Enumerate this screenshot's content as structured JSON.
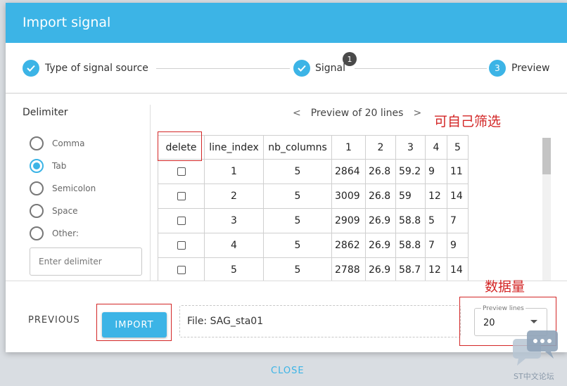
{
  "dialog": {
    "title": "Import signal"
  },
  "stepper": {
    "steps": [
      {
        "label": "Type of signal source",
        "state": "done"
      },
      {
        "label": "Signal",
        "state": "done",
        "badge": "1"
      },
      {
        "label": "Preview",
        "state": "active",
        "number": "3"
      }
    ]
  },
  "delimiter": {
    "title": "Delimiter",
    "options": [
      {
        "label": "Comma",
        "checked": false
      },
      {
        "label": "Tab",
        "checked": true
      },
      {
        "label": "Semicolon",
        "checked": false
      },
      {
        "label": "Space",
        "checked": false
      },
      {
        "label": "Other:",
        "checked": false
      }
    ],
    "input_placeholder": "Enter delimiter"
  },
  "preview": {
    "nav_prev": "<",
    "nav_text": "Preview of 20 lines",
    "nav_next": ">"
  },
  "table": {
    "headers": [
      "delete",
      "line_index",
      "nb_columns",
      "1",
      "2",
      "3",
      "4",
      "5"
    ],
    "rows": [
      [
        "1",
        "5",
        "2864",
        "26.8",
        "59.2",
        "9",
        "11"
      ],
      [
        "2",
        "5",
        "3009",
        "26.8",
        "59",
        "12",
        "14"
      ],
      [
        "3",
        "5",
        "2909",
        "26.9",
        "58.8",
        "5",
        "7"
      ],
      [
        "4",
        "5",
        "2862",
        "26.9",
        "58.8",
        "7",
        "9"
      ],
      [
        "5",
        "5",
        "2788",
        "26.9",
        "58.7",
        "12",
        "14"
      ]
    ]
  },
  "footer": {
    "previous_label": "PREVIOUS",
    "import_label": "IMPORT",
    "file_text": "File: SAG_sta01",
    "preview_lines_label": "Preview lines",
    "preview_lines_value": "20",
    "close_label": "CLOSE"
  },
  "annotations": {
    "filter_note": "可自己筛选",
    "count_note": "数据量"
  },
  "watermark": {
    "text": "ST中文论坛"
  },
  "colors": {
    "accent": "#3cb4e6",
    "annotation_red": "#d32626"
  }
}
